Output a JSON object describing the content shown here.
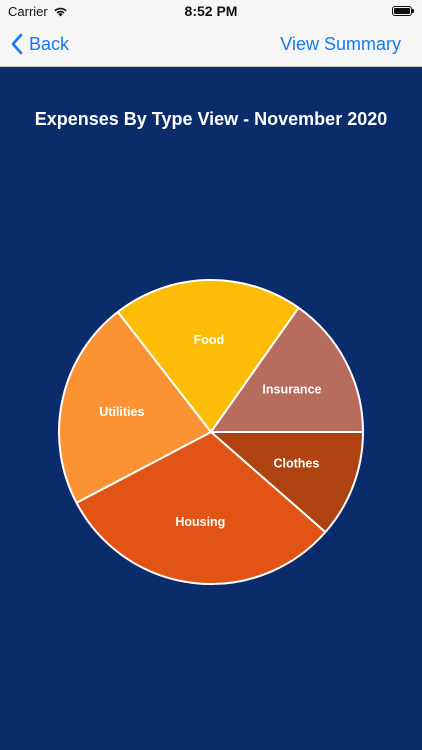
{
  "status_bar": {
    "carrier": "Carrier",
    "time": "8:52 PM"
  },
  "nav": {
    "back_label": "Back",
    "summary_label": "View Summary"
  },
  "colors": {
    "background": "#0b2c6b",
    "nav_background": "#f6f6f7",
    "link": "#1479f5"
  },
  "icons": {
    "back": "chevron-left-icon",
    "wifi": "wifi-icon",
    "battery": "battery-icon"
  },
  "chart_data": {
    "type": "pie",
    "title": "Expenses By Type View - November 2020",
    "slices": [
      {
        "label": "Clothes",
        "value": 11.8,
        "color": "#ae4211"
      },
      {
        "label": "Housing",
        "value": 31.8,
        "color": "#e15416"
      },
      {
        "label": "Utilities",
        "value": 22.9,
        "color": "#fb9233"
      },
      {
        "label": "Food",
        "value": 20.9,
        "color": "#fcbc08"
      },
      {
        "label": "Insurance",
        "value": 15.7,
        "color": "#b76c5d"
      }
    ]
  }
}
